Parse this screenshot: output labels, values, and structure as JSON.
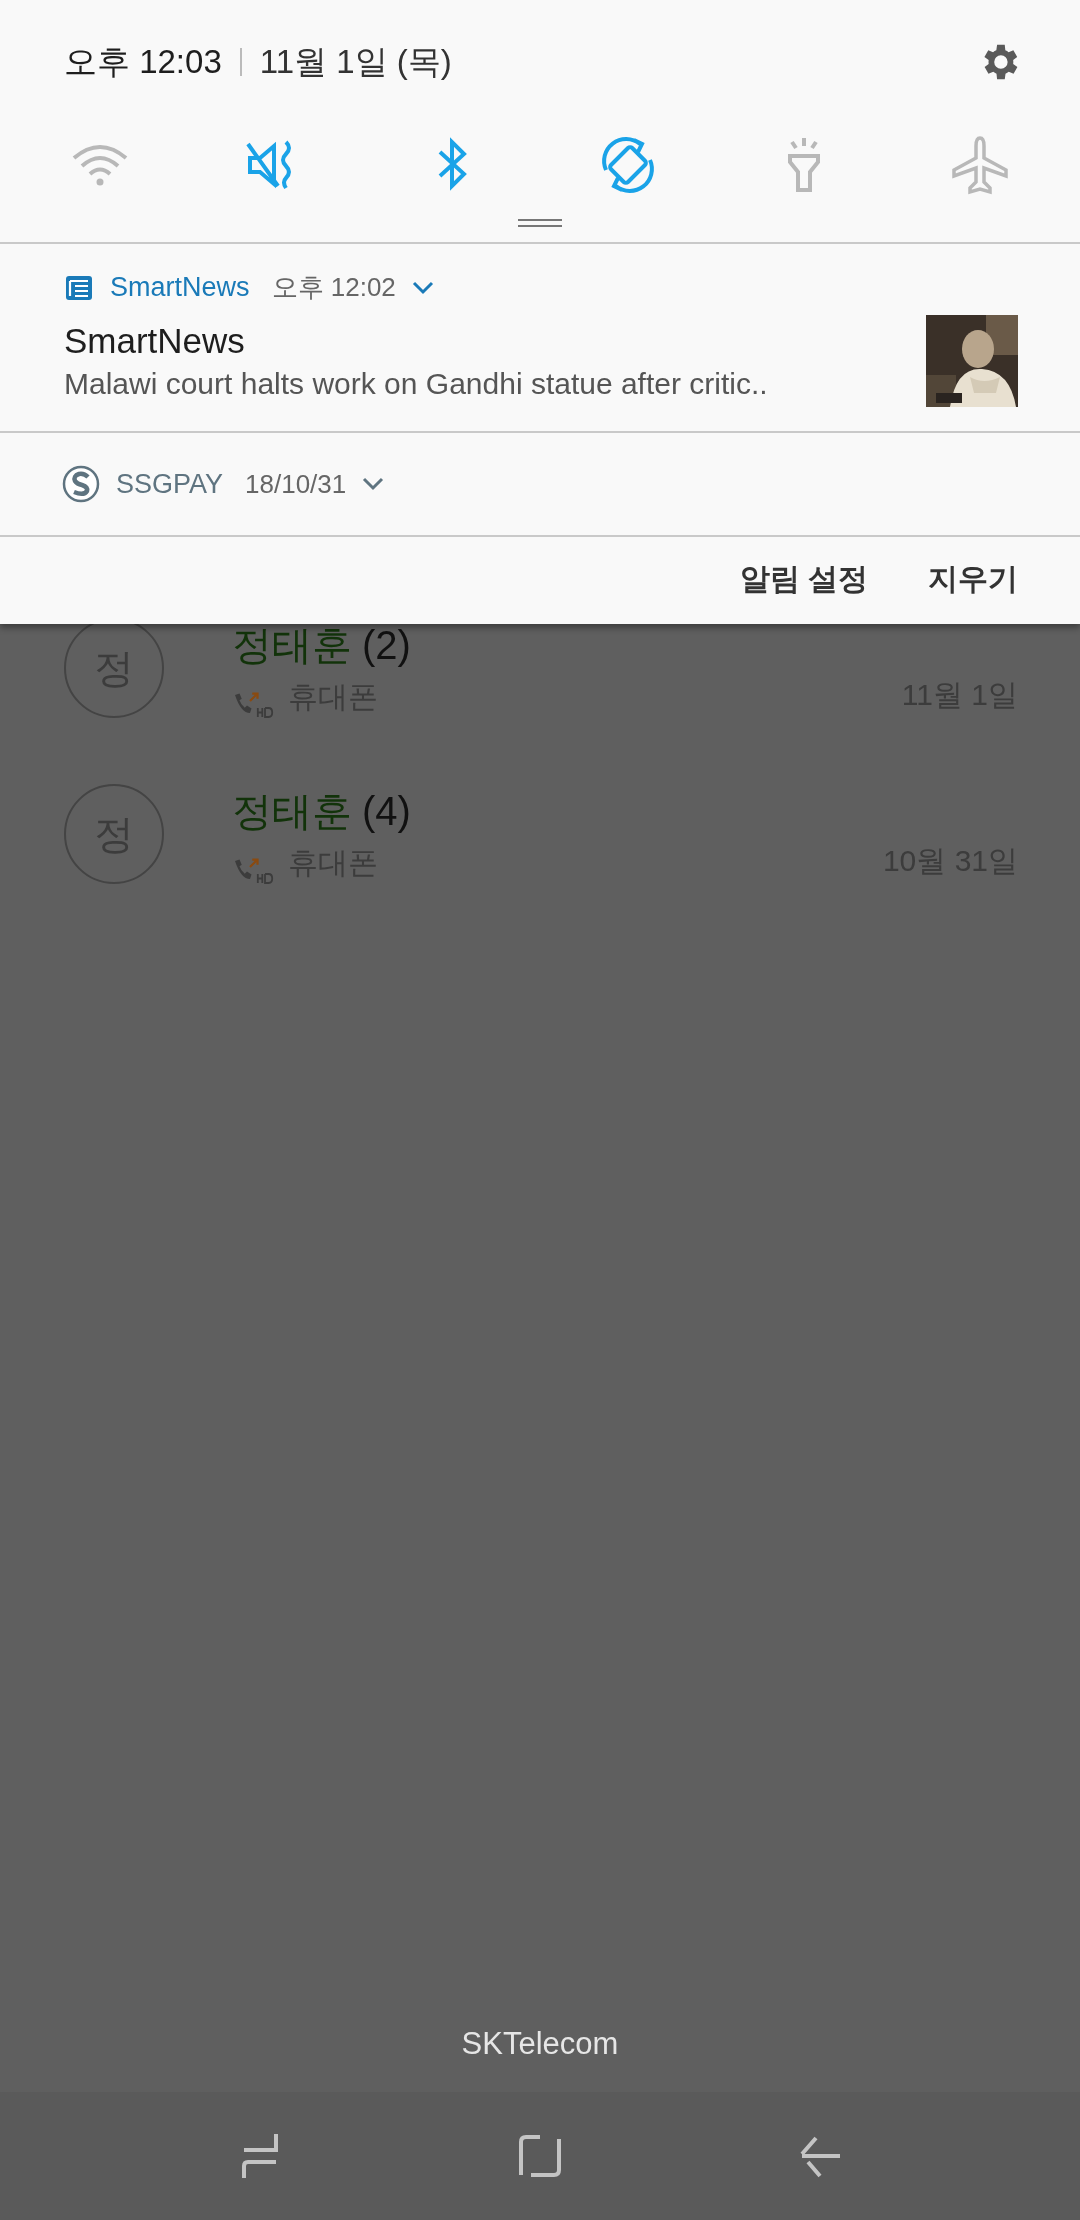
{
  "panel": {
    "time": "오후 12:03",
    "date": "11월 1일 (목)",
    "toggles": [
      {
        "kind": "wifi",
        "on": false
      },
      {
        "kind": "mute",
        "on": true
      },
      {
        "kind": "bluetooth",
        "on": true
      },
      {
        "kind": "rotate",
        "on": true
      },
      {
        "kind": "flashlight",
        "on": false
      },
      {
        "kind": "airplane",
        "on": false
      }
    ],
    "notifications": [
      {
        "kind": "expanded",
        "app": "SmartNews",
        "time": "오후 12:02",
        "title": "SmartNews",
        "text": "Malawi court halts work on Gandhi statue after critic.."
      },
      {
        "kind": "collapsed",
        "app": "SSGPAY",
        "time": "18/10/31"
      }
    ],
    "actions": [
      "알림 설정",
      "지우기"
    ]
  },
  "calls": [
    {
      "initial": "정",
      "name": "정태훈",
      "count": "(2)",
      "type": "휴대폰",
      "date": "11월 1일"
    },
    {
      "initial": "정",
      "name": "정태훈",
      "count": "(4)",
      "type": "휴대폰",
      "date": "10월 31일"
    }
  ],
  "carrier": "SKTelecom"
}
